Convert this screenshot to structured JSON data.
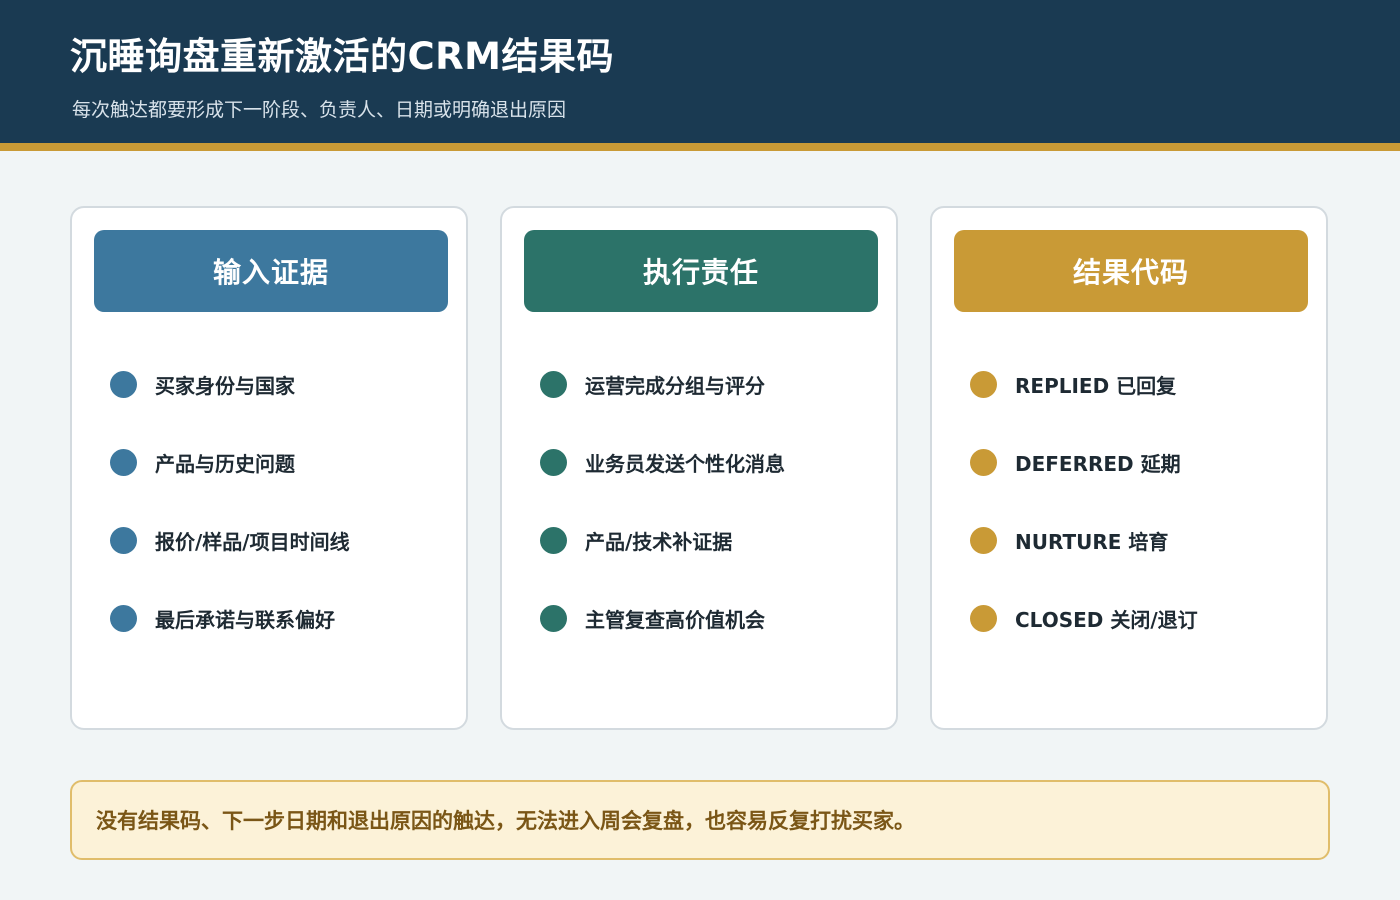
{
  "header": {
    "title": "沉睡询盘重新激活的CRM结果码",
    "subtitle": "每次触达都要形成下一阶段、负责人、日期或明确退出原因"
  },
  "columns": [
    {
      "title": "输入证据",
      "color": "#3d789e",
      "items": [
        "买家身份与国家",
        "产品与历史问题",
        "报价/样品/项目时间线",
        "最后承诺与联系偏好"
      ]
    },
    {
      "title": "执行责任",
      "color": "#2c7369",
      "items": [
        "运营完成分组与评分",
        "业务员发送个性化消息",
        "产品/技术补证据",
        "主管复查高价值机会"
      ]
    },
    {
      "title": "结果代码",
      "color": "#c99a36",
      "items": [
        "REPLIED 已回复",
        "DEFERRED 延期",
        "NURTURE 培育",
        "CLOSED 关闭/退订"
      ]
    }
  ],
  "footer": {
    "note": "没有结果码、下一步日期和退出原因的触达，无法进入周会复盘，也容易反复打扰买家。"
  }
}
